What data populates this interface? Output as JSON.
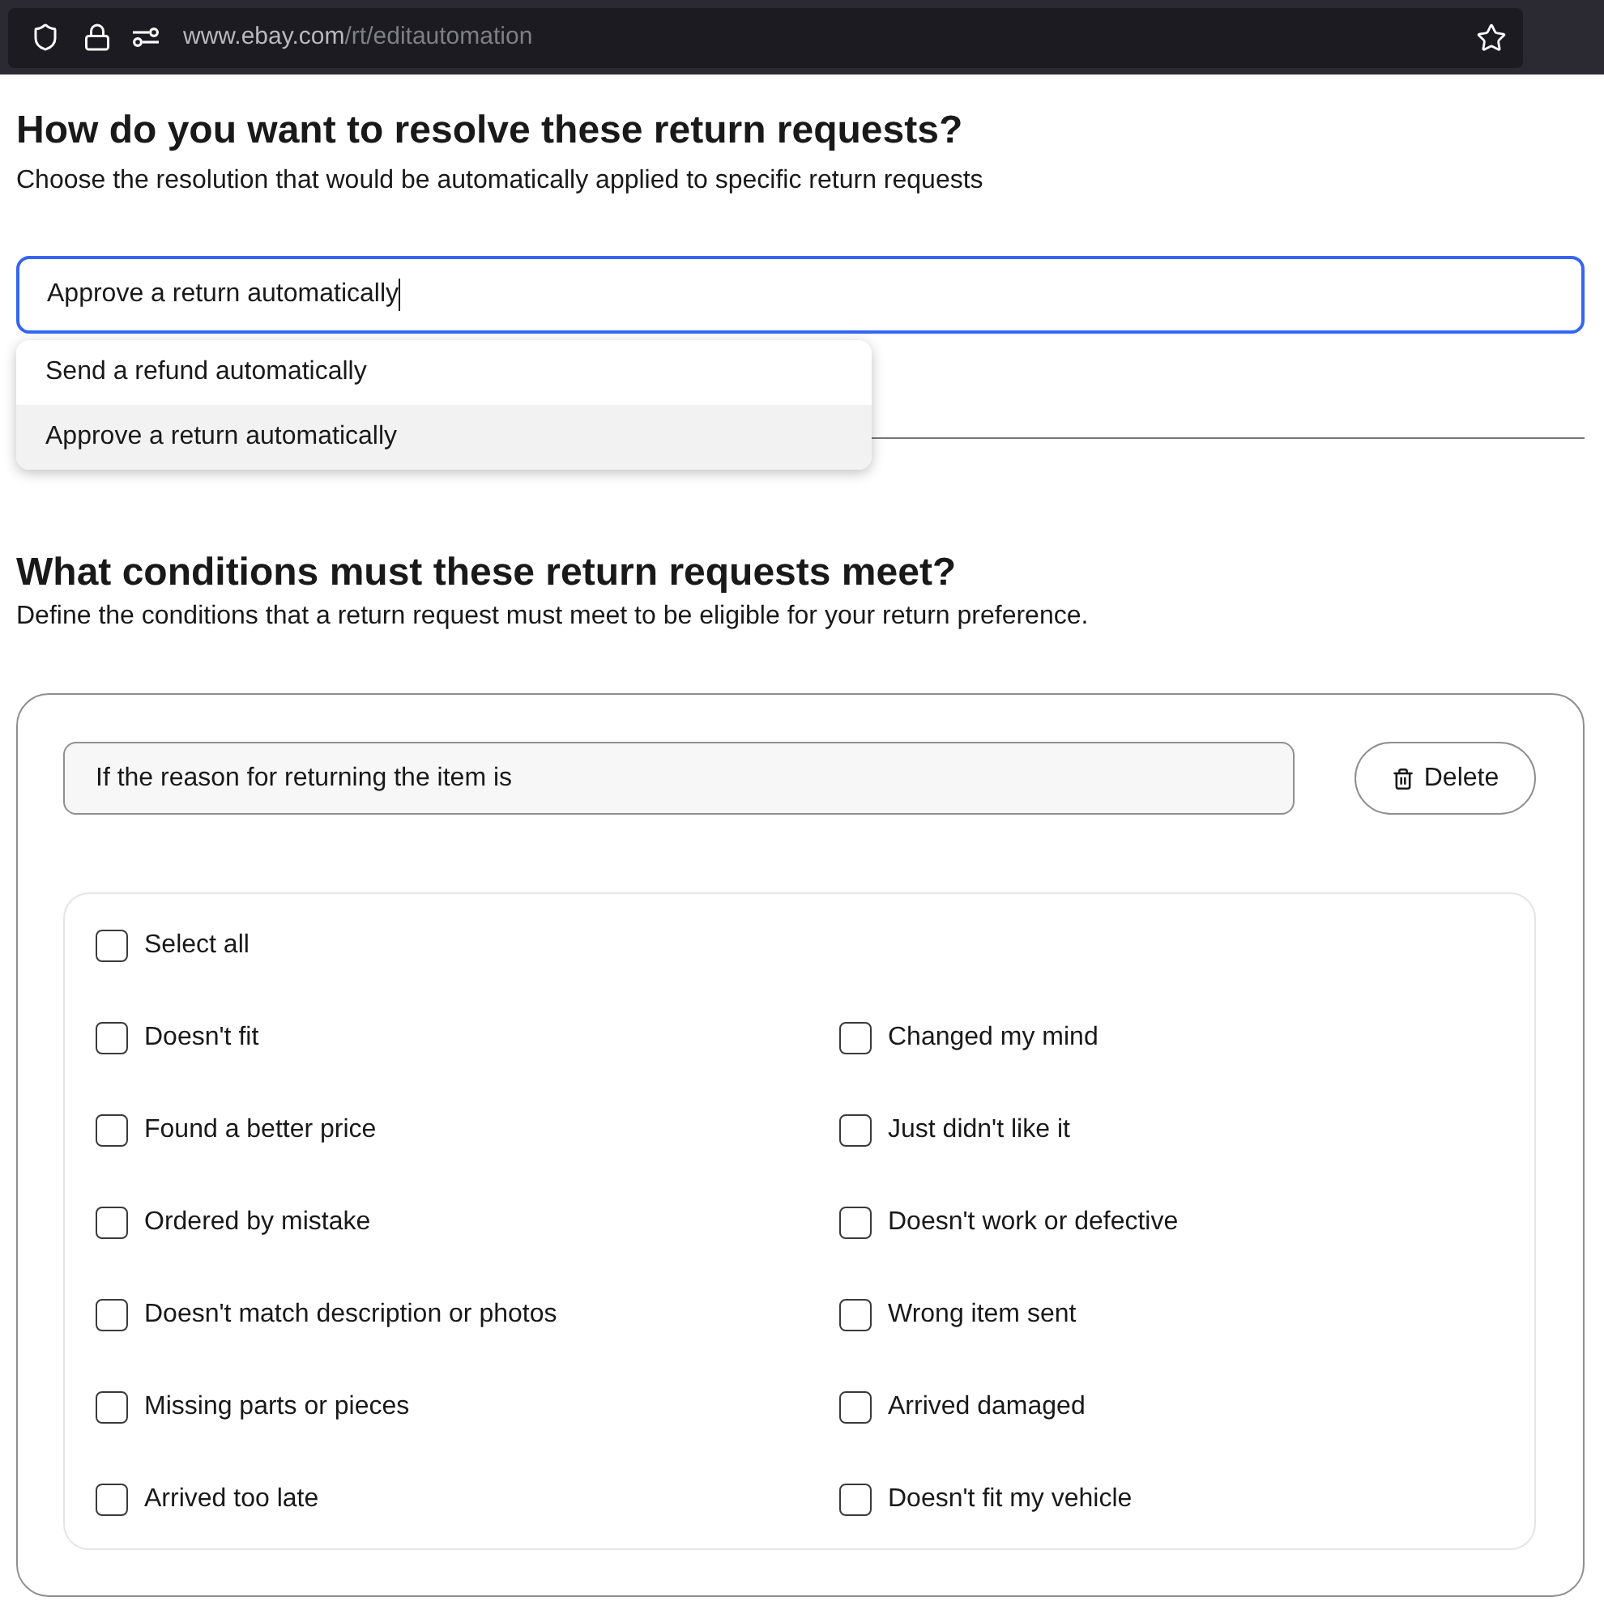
{
  "browser": {
    "url_host": "www.ebay.com",
    "url_path": "/rt/editautomation"
  },
  "resolution": {
    "title": "How do you want to resolve these return requests?",
    "description": "Choose the resolution that would be automatically applied to specific return requests",
    "field": {
      "value": "Approve a return automatically",
      "focused": true
    },
    "options": [
      {
        "label": "Send a refund automatically",
        "selected": false
      },
      {
        "label": "Approve a return automatically",
        "selected": true
      }
    ]
  },
  "conditions": {
    "title": "What conditions must these return requests meet?",
    "description": "Define the conditions that a return request must meet to be eligible for your return preference.",
    "rule": {
      "value": "If the reason for returning the item is"
    },
    "delete_button": "Delete",
    "select_all": {
      "label": "Select all",
      "checked": false
    },
    "reasons": [
      {
        "label": "Doesn't fit",
        "checked": false
      },
      {
        "label": "Changed my mind",
        "checked": false
      },
      {
        "label": "Found a better price",
        "checked": false
      },
      {
        "label": "Just didn't like it",
        "checked": false
      },
      {
        "label": "Ordered by mistake",
        "checked": false
      },
      {
        "label": "Doesn't work or defective",
        "checked": false
      },
      {
        "label": "Doesn't match description or photos",
        "checked": false
      },
      {
        "label": "Wrong item sent",
        "checked": false
      },
      {
        "label": "Missing parts or pieces",
        "checked": false
      },
      {
        "label": "Arrived damaged",
        "checked": false
      },
      {
        "label": "Arrived too late",
        "checked": false
      },
      {
        "label": "Doesn't fit my vehicle",
        "checked": false
      }
    ]
  }
}
